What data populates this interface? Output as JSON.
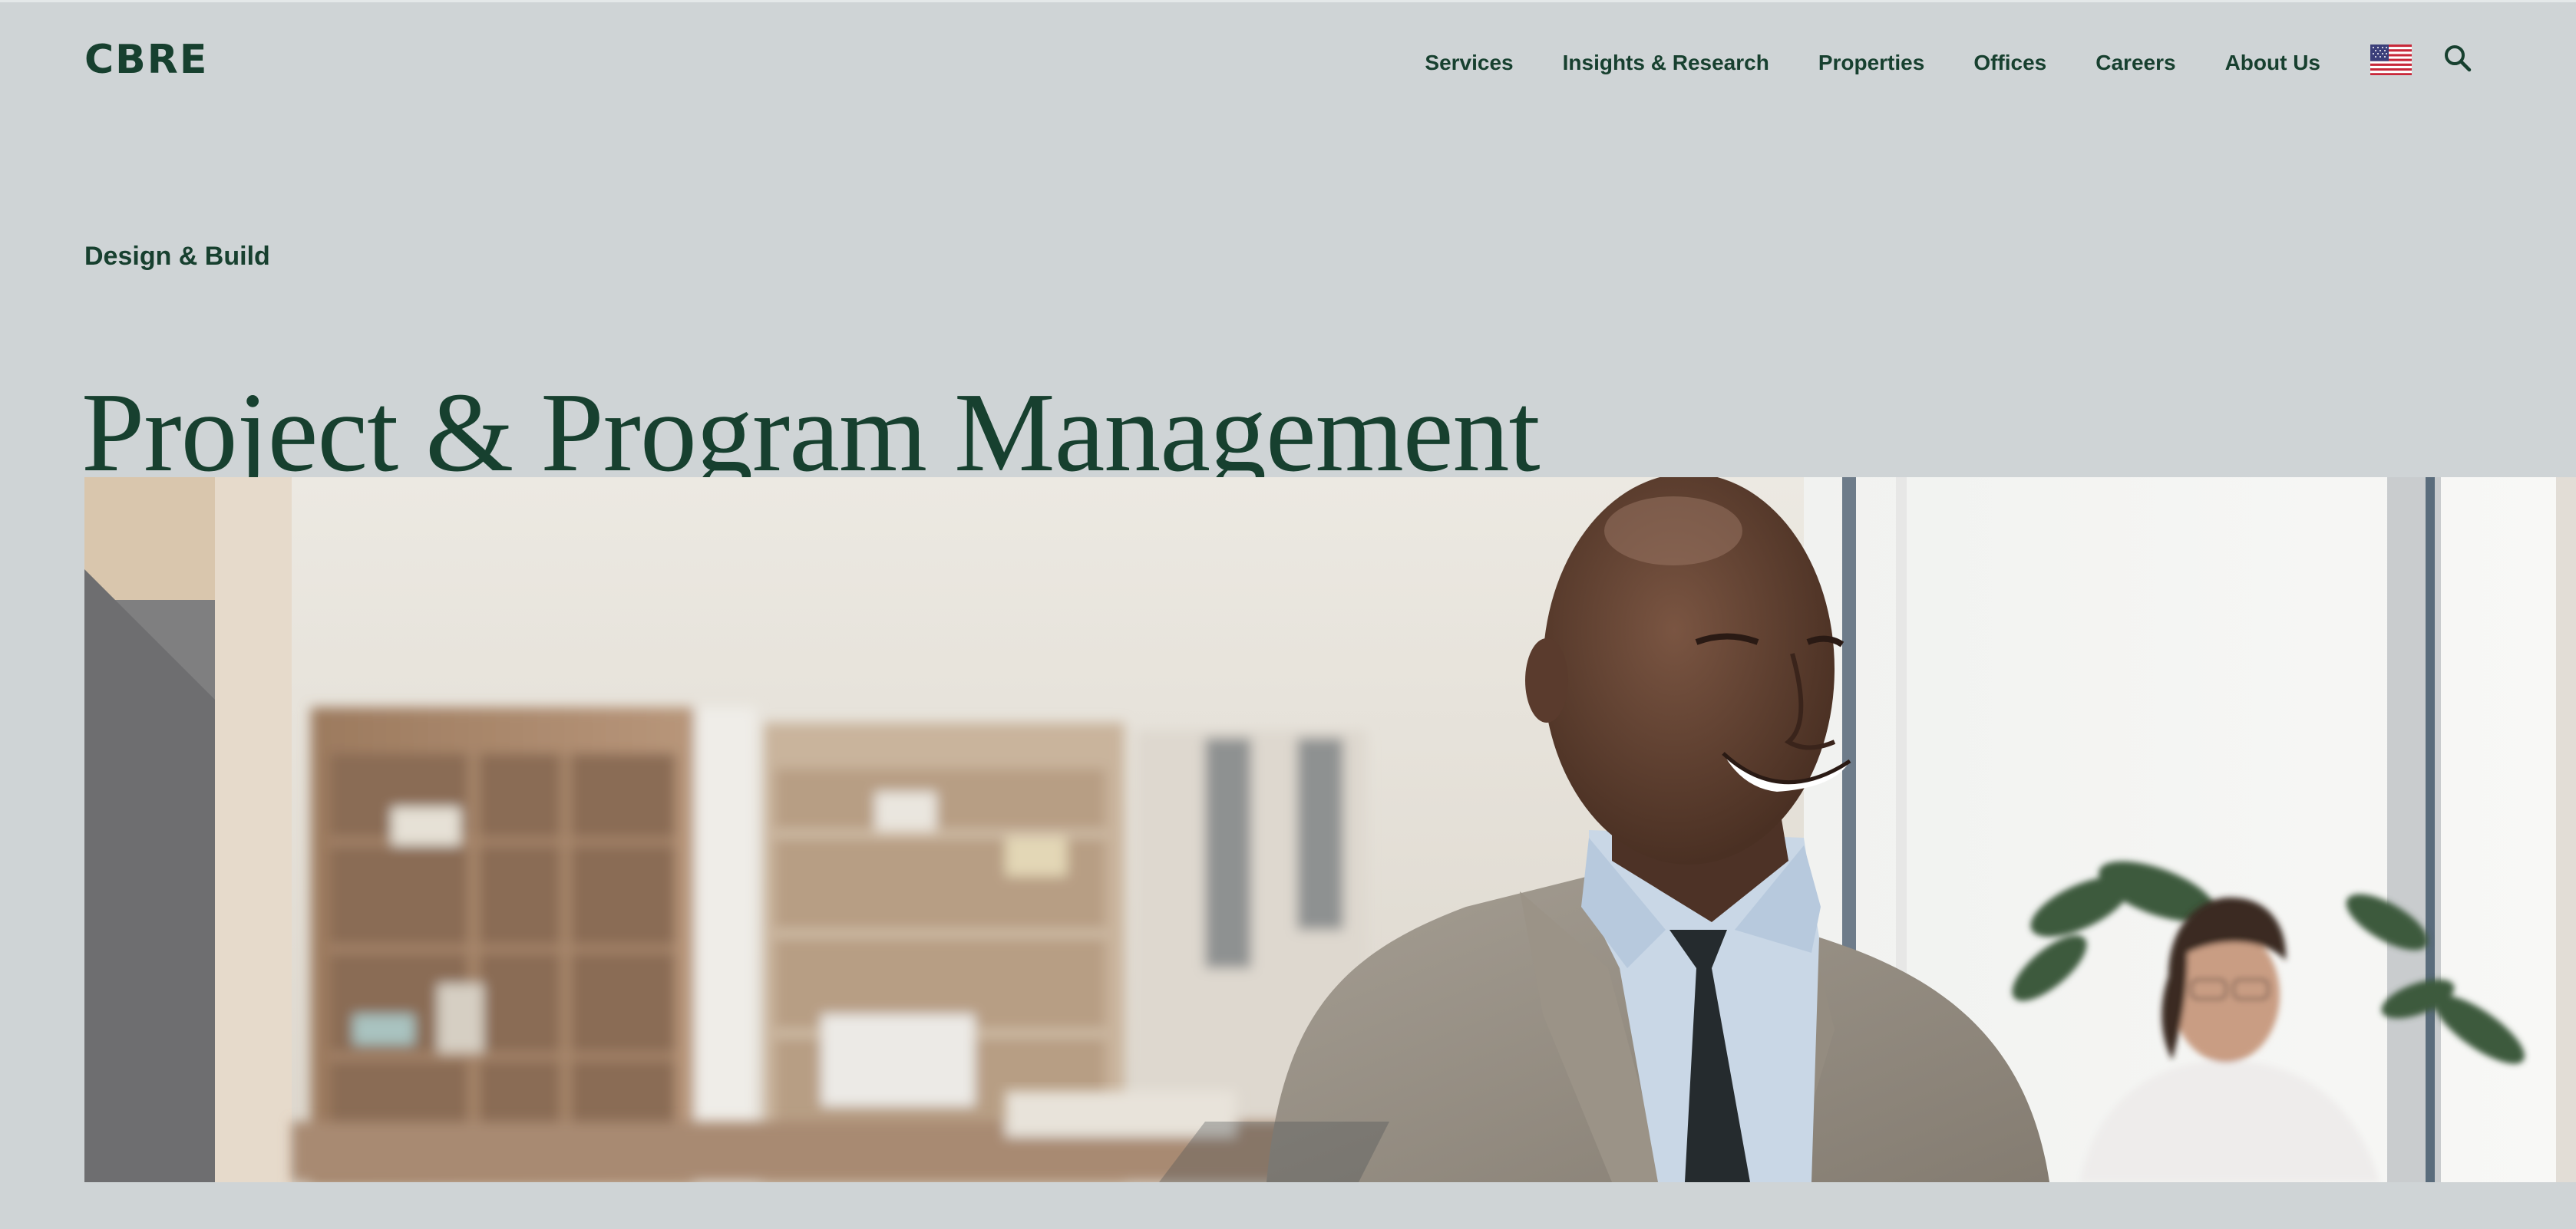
{
  "header": {
    "logo": "CBRE",
    "nav": [
      {
        "label": "Services"
      },
      {
        "label": "Insights & Research"
      },
      {
        "label": "Properties"
      },
      {
        "label": "Offices"
      },
      {
        "label": "Careers"
      },
      {
        "label": "About Us"
      }
    ],
    "locale_icon": "us-flag-icon",
    "search_icon": "search-icon"
  },
  "hero": {
    "eyebrow": "Design & Build",
    "title": "Project & Program Management",
    "image_description_icon": "office-people-photo"
  },
  "colors": {
    "brand_green": "#17402f",
    "page_background": "#cfd4d6"
  }
}
